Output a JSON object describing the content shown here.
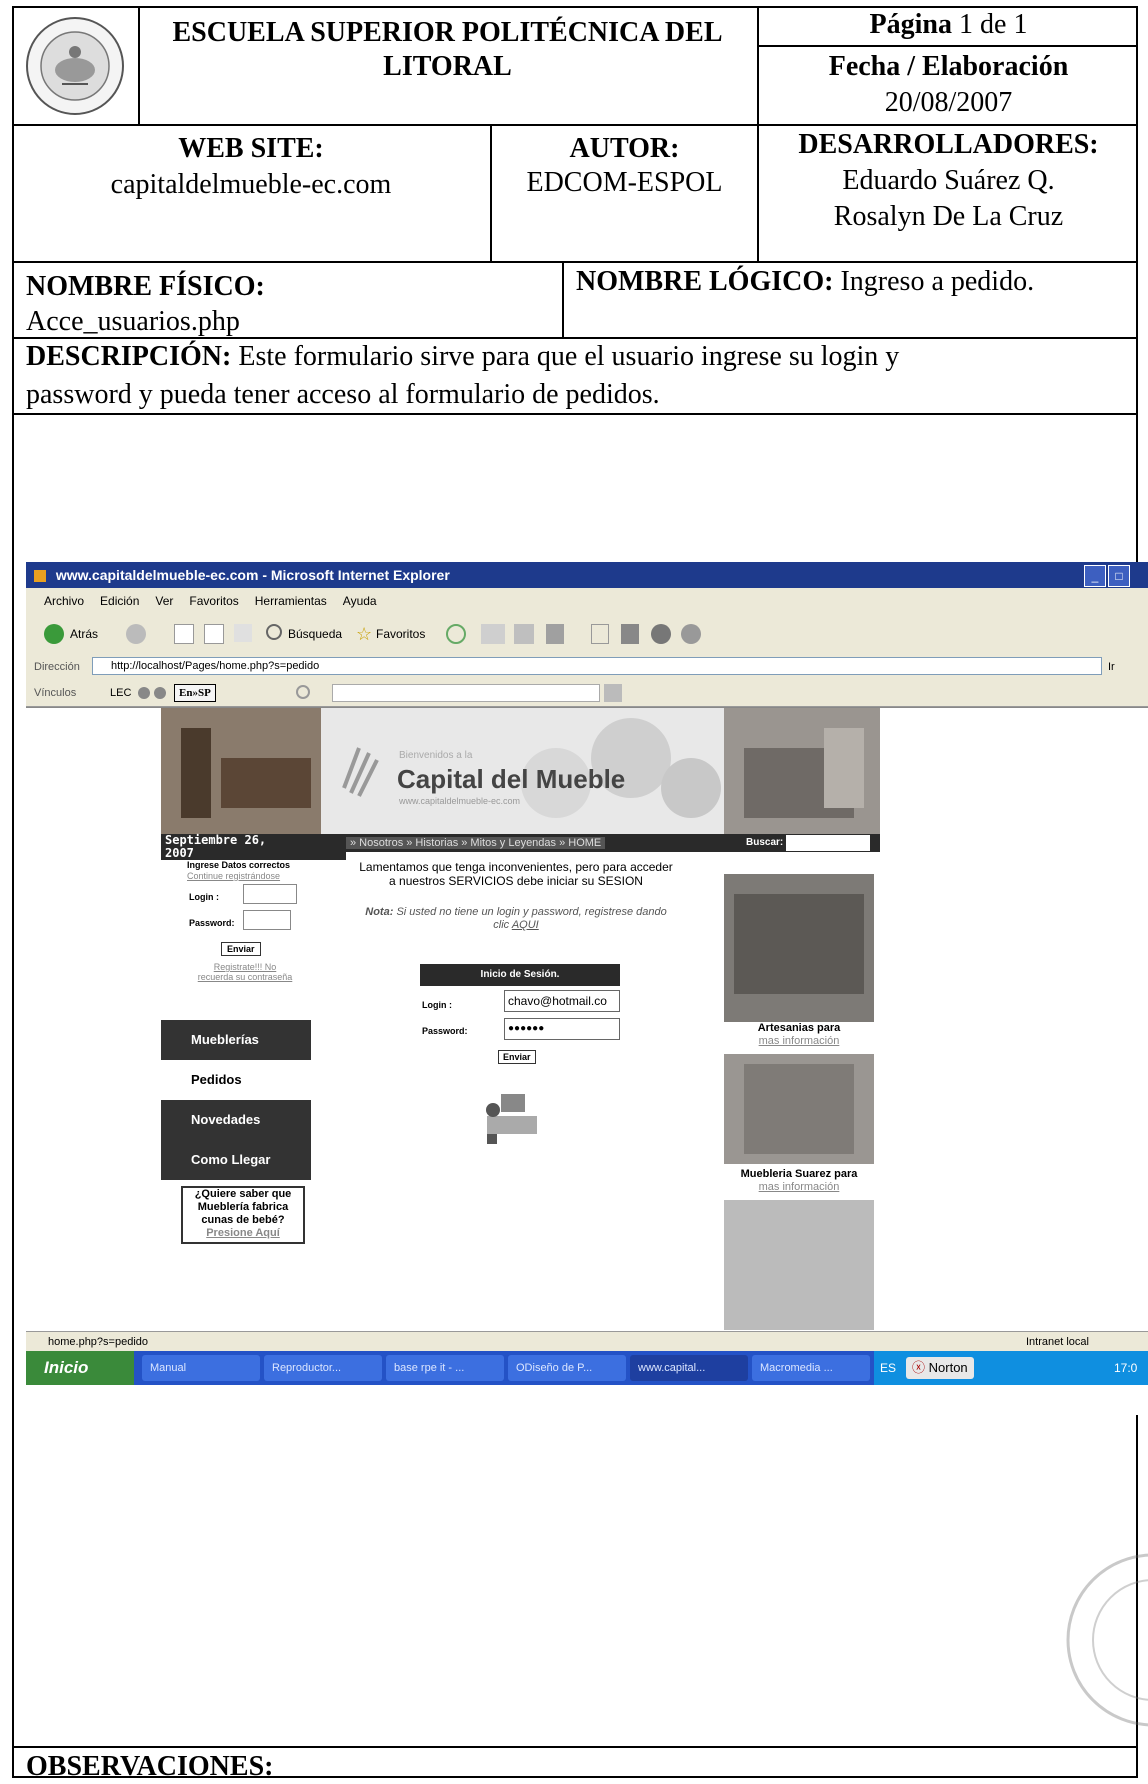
{
  "header": {
    "institution": "ESCUELA SUPERIOR POLITÉCNICA DEL LITORAL",
    "logo_text": "ESCUELA SUPERIOR POLITECNICA DEL LITORAL ESPOL",
    "page_label": "Página",
    "page_current": "1",
    "page_of": "de 1",
    "date_label": "Fecha / Elaboración",
    "date_value": "20/08/2007"
  },
  "info": {
    "website_label": "WEB SITE:",
    "website_value": "capitaldelmueble-ec.com",
    "author_label": "AUTOR:",
    "author_value": "EDCOM-ESPOL",
    "developers_label": "DESARROLLADORES:",
    "developer_1": "Eduardo Suárez Q.",
    "developer_2": "Rosalyn De La Cruz"
  },
  "names": {
    "physical_label": "NOMBRE FÍSICO:",
    "physical_value": "Acce_usuarios.php",
    "logical_label": "NOMBRE LÓGICO:",
    "logical_value": "Ingreso a pedido."
  },
  "description": {
    "label": "DESCRIPCIÓN:",
    "text_line1": "Este formulario sirve para que el usuario ingrese su login y",
    "text_line2": "password y pueda tener acceso al formulario de pedidos."
  },
  "observations_label": "OBSERVACIONES:",
  "browser": {
    "title": "www.capitaldelmueble-ec.com - Microsoft Internet Explorer",
    "menu": [
      "Archivo",
      "Edición",
      "Ver",
      "Favoritos",
      "Herramientas",
      "Ayuda"
    ],
    "back_label": "Atrás",
    "search_label": "Búsqueda",
    "favorites_label": "Favoritos",
    "address_label": "Dirección",
    "address_value": "http://localhost/Pages/home.php?s=pedido",
    "go_label": "Ir",
    "links_label": "Vínculos",
    "lec_label": "LEC",
    "translate_label": "En»SP",
    "status_url": "home.php?s=pedido",
    "status_zone": "Intranet local"
  },
  "taskbar": {
    "start": "Inicio",
    "tasks": [
      "Manual",
      "Reproductor...",
      "base rpe it - ...",
      "ODiseño de P...",
      "www.capital...",
      "Macromedia ..."
    ],
    "lang": "ES",
    "norton": "Norton",
    "clock": "17:0"
  },
  "site": {
    "welcome": "Bienvenidos a la",
    "brand": "Capital del Mueble",
    "brand_url": "www.capitaldelmueble-ec.com",
    "date_line1": "Septiembre 26,",
    "date_line2": "2007",
    "topnav": "» Nosotros » Historias » Mitos y Leyendas » HOME",
    "search_label": "Buscar:",
    "side_login_title": "Ingrese Datos correctos",
    "side_login_link": "Continue registrándose",
    "side_login_label": "Login :",
    "side_password_label": "Password:",
    "side_send": "Enviar",
    "side_register": "Registrate!!! No recuerda su contraseña",
    "nav": [
      "Mueblerías",
      "Pedidos",
      "Novedades",
      "Como Llegar"
    ],
    "promo_text": "¿Quiere saber que Mueblería fabrica cunas de bebé?",
    "promo_link": "Presione Aquí",
    "msg_line1": "Lamentamos que tenga inconvenientes, pero para acceder",
    "msg_line2": "a nuestros SERVICIOS debe iniciar su SESION",
    "note_label": "Nota:",
    "note_text": "Si usted no tiene un login y password, registrese dando",
    "note_text2": "clic",
    "note_link": "AQUI",
    "session_title": "Inicio de Sesión.",
    "login_label": "Login :",
    "login_value": "chavo@hotmail.co",
    "password_label": "Password:",
    "password_value": "●●●●●●",
    "send_label": "Enviar",
    "ad1_title": "Artesanias para",
    "ad1_link": "mas información",
    "ad2_title": "Muebleria Suarez para",
    "ad2_link": "mas información"
  }
}
